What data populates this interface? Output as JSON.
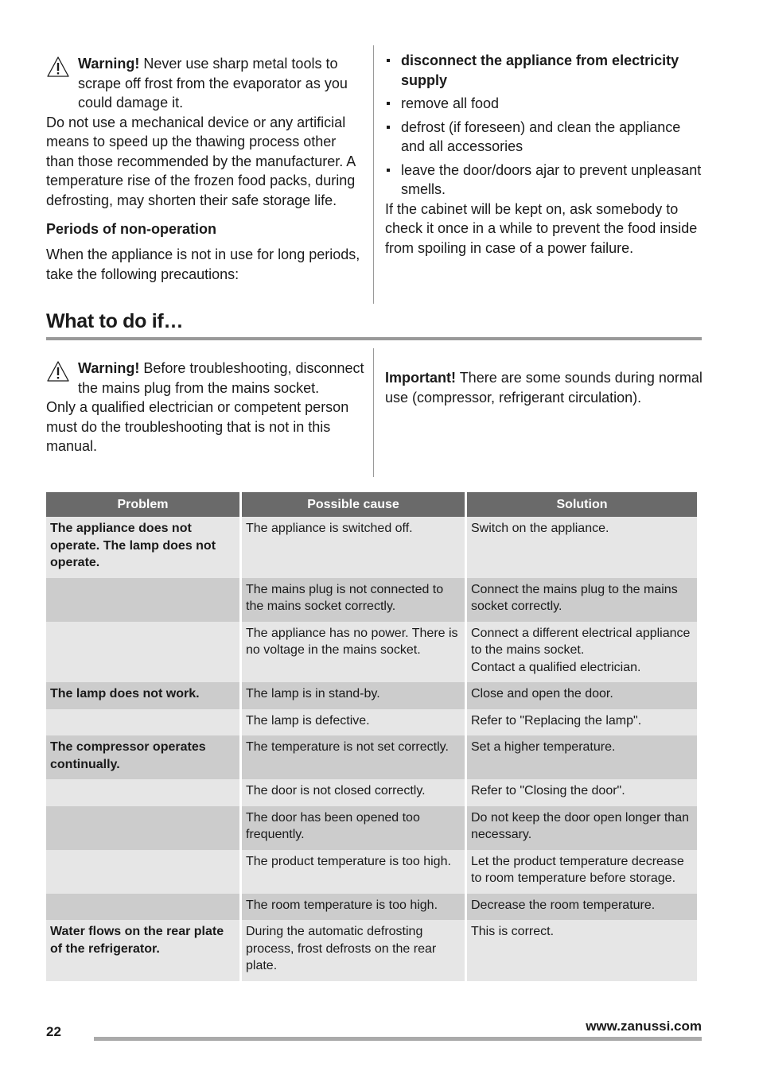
{
  "section1": {
    "warning": {
      "icon": "warning-triangle-icon",
      "label": "Warning!",
      "text_first": "Never use sharp metal tools to scrape off frost from the evaporator as you could damage it."
    },
    "para1": "Do not use a mechanical device or any artificial means to speed up the thawing process other than those recommended by the manufacturer. A temperature rise of the frozen food packs, during defrosting, may shorten their safe storage life.",
    "subheading": "Periods of non-operation",
    "para2": "When the appliance is not in use for long periods, take the following precautions:",
    "bullets": [
      "disconnect the appliance from electricity supply",
      "remove all food",
      "defrost (if foreseen) and clean the appliance and all accessories",
      "leave the door/doors ajar to prevent unpleasant smells."
    ],
    "para3": "If the cabinet will be kept on, ask somebody to check it once in a while to prevent the food inside from spoiling in case of a power failure."
  },
  "section2": {
    "title": "What to do if…",
    "warning": {
      "icon": "warning-triangle-icon",
      "label": "Warning!",
      "text_first": "Before troubleshooting, disconnect the mains plug from the mains socket."
    },
    "para1": "Only a qualified electrician or competent person must do the troubleshooting that is not in this manual.",
    "important": {
      "label": "Important!",
      "text": "There are some sounds during normal use (compressor, refrigerant circulation)."
    }
  },
  "table": {
    "headers": [
      "Problem",
      "Possible cause",
      "Solution"
    ],
    "rows": [
      {
        "problem": "The appliance does not operate. The lamp does not operate.",
        "cause": "The appliance is switched off.",
        "solution": "Switch on the appliance."
      },
      {
        "problem": "",
        "cause": "The mains plug is not connected to the mains socket correctly.",
        "solution": "Connect the mains plug to the mains socket correctly."
      },
      {
        "problem": "",
        "cause": "The appliance has no power. There is no voltage in the mains socket.",
        "solution": "Connect a different electrical appliance to the mains socket.\nContact a qualified electrician."
      },
      {
        "problem": "The lamp does not work.",
        "cause": "The lamp is in stand-by.",
        "solution": "Close and open the door."
      },
      {
        "problem": "",
        "cause": "The lamp is defective.",
        "solution": "Refer to \"Replacing the lamp\"."
      },
      {
        "problem": "The compressor operates continually.",
        "cause": "The temperature is not set correctly.",
        "solution": "Set a higher temperature."
      },
      {
        "problem": "",
        "cause": "The door is not closed correctly.",
        "solution": "Refer to \"Closing the door\"."
      },
      {
        "problem": "",
        "cause": "The door has been opened too frequently.",
        "solution": "Do not keep the door open longer than necessary."
      },
      {
        "problem": "",
        "cause": "The product temperature is too high.",
        "solution": "Let the product temperature decrease to room temperature before storage."
      },
      {
        "problem": "",
        "cause": "The room temperature is too high.",
        "solution": "Decrease the room temperature."
      },
      {
        "problem": "Water flows on the rear plate of the refrigerator.",
        "cause": "During the automatic defrosting process, frost defrosts on the rear plate.",
        "solution": "This is correct."
      }
    ]
  },
  "footer": {
    "page_number": "22",
    "url": "www.zanussi.com"
  },
  "colors": {
    "header_bg": "#6a6a6a",
    "row_light": "#e6e6e6",
    "row_dark": "#cccccc",
    "rule": "#999999"
  }
}
